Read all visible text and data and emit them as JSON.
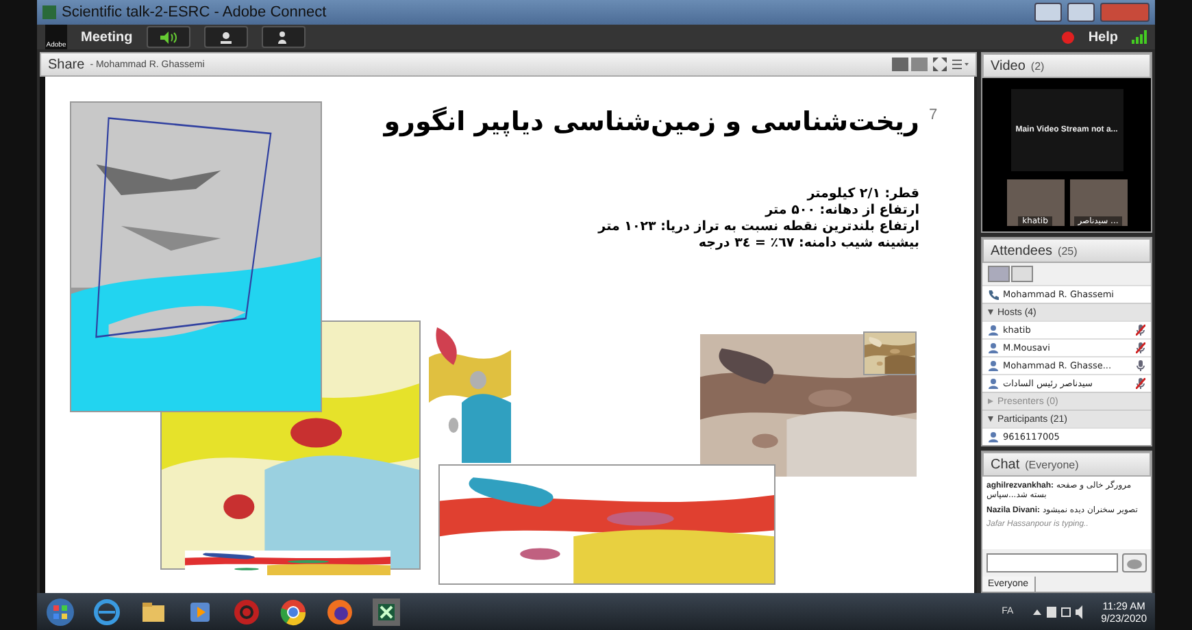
{
  "window": {
    "title": "Scientific talk-2-ESRC - Adobe Connect"
  },
  "toolbar": {
    "logo": "Adobe",
    "meeting_menu": "Meeting",
    "help_menu": "Help"
  },
  "share": {
    "title": "Share",
    "presenter": "- Mohammad R. Ghassemi",
    "slide": {
      "number": "7",
      "title": "ریخت‌شناسی و زمین‌شناسی دیاپیر انگورو",
      "lines": [
        "قطر: ۲/۱ کیلومتر",
        "ارتفاع از دهانه: ۵۰۰ متر",
        "ارتفاع بلندترین نقطه نسبت به تراز دریا: ۱۰۲۳ متر",
        "بیشینه شیب دامنه: ٦٧٪ = ٣٤ درجه"
      ]
    }
  },
  "video": {
    "title": "Video",
    "count": "(2)",
    "message": "Main Video Stream not a...",
    "thumbnails": [
      {
        "name": "khatib"
      },
      {
        "name": "سیدناصر ..."
      }
    ]
  },
  "attendees": {
    "title": "Attendees",
    "count": "(25)",
    "presenter": "Mohammad R. Ghassemi",
    "groups": [
      {
        "label": "Hosts (4)",
        "expanded": true,
        "members": [
          {
            "name": "khatib",
            "muted": true
          },
          {
            "name": "M.Mousavi",
            "muted": true
          },
          {
            "name": "Mohammad R. Ghasse...",
            "muted": false
          },
          {
            "name": "سیدناصر رئیس السادات",
            "muted": true
          }
        ]
      },
      {
        "label": "Presenters (0)",
        "expanded": false
      },
      {
        "label": "Participants (21)",
        "expanded": true,
        "members": [
          {
            "name": "9616117005"
          }
        ]
      }
    ]
  },
  "chat": {
    "title": "Chat",
    "scope": "(Everyone)",
    "messages": [
      {
        "sender": "aghilrezvankhah:",
        "text": "مرورگر خالی و صفحه بسته شد...سپاس"
      },
      {
        "sender": "Nazila Divani:",
        "text": "تصویر سخنران دیده نمیشود"
      }
    ],
    "typing": "Jafar Hassanpour is typing..",
    "tab": "Everyone"
  },
  "taskbar": {
    "language": "FA",
    "time": "11:29 AM",
    "date": "9/23/2020"
  }
}
